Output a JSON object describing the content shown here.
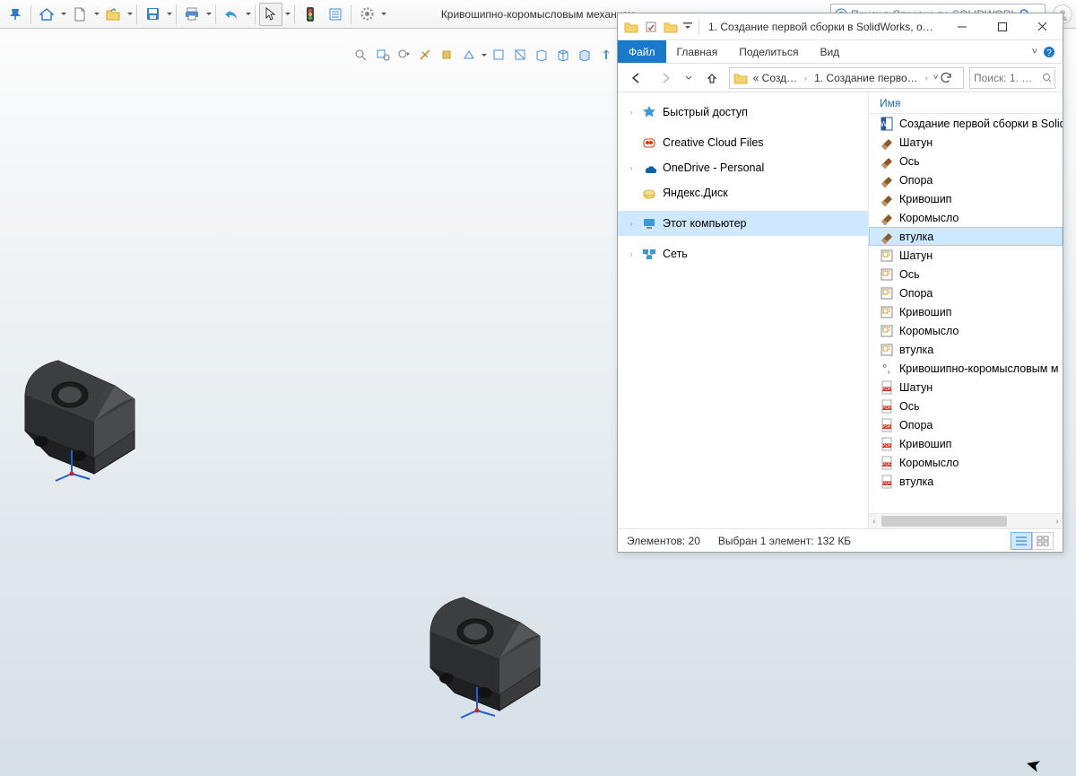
{
  "sw": {
    "title": "Кривошипно-коромысловым механизм",
    "search_placeholder": "Поиск в Справке по SOLIDWORKS"
  },
  "explorer": {
    "title": "1. Создание первой сборки в SolidWorks, ос…",
    "tabs": {
      "file": "Файл",
      "home": "Главная",
      "share": "Поделиться",
      "view": "Вид"
    },
    "breadcrumb": {
      "seg1": "« Созд…",
      "seg2": "1. Создание перво…"
    },
    "search_placeholder": "Поиск: 1. …",
    "list_header": "Имя",
    "nav": [
      {
        "label": "Быстрый доступ",
        "icon": "star",
        "expandable": true
      },
      {
        "label": "Creative Cloud Files",
        "icon": "cc",
        "expandable": false
      },
      {
        "label": "OneDrive - Personal",
        "icon": "onedrive",
        "expandable": true
      },
      {
        "label": "Яндекс.Диск",
        "icon": "yadisk",
        "expandable": false
      },
      {
        "label": "Этот компьютер",
        "icon": "pc",
        "expandable": true,
        "selected": true
      },
      {
        "label": "Сеть",
        "icon": "network",
        "expandable": true
      }
    ],
    "files": [
      {
        "name": "Создание первой сборки в Solid",
        "type": "docx"
      },
      {
        "name": "Шатун",
        "type": "sldprt"
      },
      {
        "name": "Ось",
        "type": "sldprt"
      },
      {
        "name": "Опора",
        "type": "sldprt"
      },
      {
        "name": "Кривошип",
        "type": "sldprt"
      },
      {
        "name": "Коромысло",
        "type": "sldprt"
      },
      {
        "name": "втулка",
        "type": "sldprt",
        "selected": true
      },
      {
        "name": "Шатун",
        "type": "slddrw"
      },
      {
        "name": "Ось",
        "type": "slddrw"
      },
      {
        "name": "Опора",
        "type": "slddrw"
      },
      {
        "name": "Кривошип",
        "type": "slddrw"
      },
      {
        "name": "Коромысло",
        "type": "slddrw"
      },
      {
        "name": "втулка",
        "type": "slddrw"
      },
      {
        "name": "Кривошипно-коромысловым м",
        "type": "sldasm"
      },
      {
        "name": "Шатун",
        "type": "pdf"
      },
      {
        "name": "Ось",
        "type": "pdf"
      },
      {
        "name": "Опора",
        "type": "pdf"
      },
      {
        "name": "Кривошип",
        "type": "pdf"
      },
      {
        "name": "Коромысло",
        "type": "pdf"
      },
      {
        "name": "втулка",
        "type": "pdf"
      }
    ],
    "status": {
      "count": "Элементов: 20",
      "selection": "Выбран 1 элемент: 132 КБ"
    }
  }
}
